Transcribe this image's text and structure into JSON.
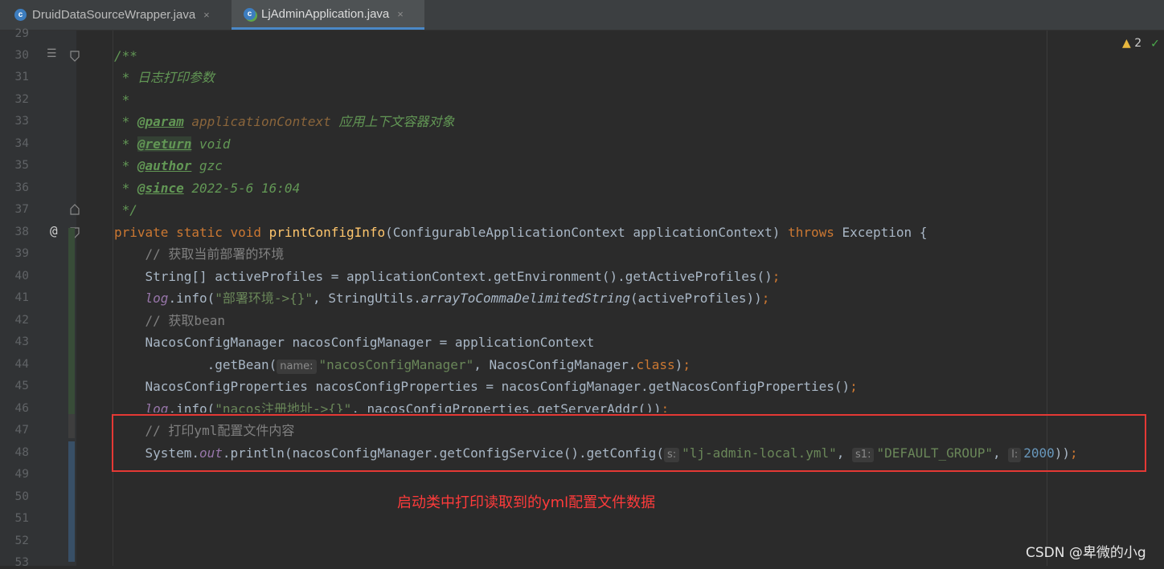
{
  "tabs": [
    {
      "icon": "class-c-icon",
      "icon_letter": "c",
      "label": "DruidDataSourceWrapper.java",
      "close": "×"
    },
    {
      "icon": "springboot-class-icon",
      "icon_letter": "c",
      "label": "LjAdminApplication.java",
      "close": "×"
    }
  ],
  "inspections": {
    "warning_icon": "warning-triangle-icon",
    "warning_symbol": "▲",
    "warning_count": "2",
    "ok_icon": "double-check-icon",
    "ok_symbol": "✓"
  },
  "line_numbers": [
    "29",
    "30",
    "31",
    "32",
    "33",
    "34",
    "35",
    "36",
    "37",
    "38",
    "39",
    "40",
    "41",
    "42",
    "43",
    "44",
    "45",
    "46",
    "47",
    "48",
    "49",
    "50",
    "51",
    "52",
    "53"
  ],
  "gutter": {
    "doc_icon": "☰",
    "override_symbol": "@"
  },
  "code": {
    "l30": "/**",
    "l31": " * 日志打印参数",
    "l32": " *",
    "l33_star": " * ",
    "l33_tag": "@param",
    "l33_param": " applicationContext",
    "l33_text": " 应用上下文容器对象",
    "l34_star": " * ",
    "l34_tag": "@return",
    "l34_text": " void",
    "l35_star": " * ",
    "l35_tag": "@author",
    "l35_text": " gzc",
    "l36_star": " * ",
    "l36_tag": "@since",
    "l36_text": " 2022-5-6 16:04",
    "l37": " */",
    "l38_kw1": "private static void ",
    "l38_fn": "printConfigInfo",
    "l38_args": "(ConfigurableApplicationContext applicationContext) ",
    "l38_kw2": "throws",
    "l38_rest": " Exception {",
    "l39": "    // 获取当前部署的环境",
    "l40_a": "    String[] activeProfiles = applicationContext.getEnvironment().getActiveProfiles()",
    "l40_semi": ";",
    "l41_log": "log",
    "l41_a": ".info(",
    "l41_str": "\"部署环境->{}\"",
    "l41_b": ", StringUtils.",
    "l41_ital": "arrayToCommaDelimitedString",
    "l41_c": "(activeProfiles))",
    "l41_semi": ";",
    "l42": "    // 获取bean",
    "l43": "    NacosConfigManager nacosConfigManager = applicationContext",
    "l44_a": "            .getBean(",
    "l44_hint": "name:",
    "l44_str": "\"nacosConfigManager\"",
    "l44_b": ", NacosConfigManager.",
    "l44_kw": "class",
    "l44_c": ")",
    "l44_semi": ";",
    "l45_a": "    NacosConfigProperties nacosConfigProperties = nacosConfigManager.getNacosConfigProperties()",
    "l45_semi": ";",
    "l46_log": "log",
    "l46_a": ".info(",
    "l46_str": "\"nacos注册地址->{}\"",
    "l46_b": ", nacosConfigProperties.getServerAddr())",
    "l46_semi": ";",
    "l47": "    // 打印yml配置文件内容",
    "l48_a": "    System.",
    "l48_out": "out",
    "l48_b": ".println(nacosConfigManager.getConfigService().getConfig(",
    "l48_hint1": "s:",
    "l48_str1": "\"lj-admin-local.yml\"",
    "l48_comma1": ", ",
    "l48_hint2": "s1:",
    "l48_str2": "\"DEFAULT_GROUP\"",
    "l48_comma2": ", ",
    "l48_hint3": "l:",
    "l48_num": "2000",
    "l48_c": "))",
    "l48_semi": ";"
  },
  "annotation": "启动类中打印读取到的yml配置文件数据",
  "watermark": "CSDN @卑微的小g"
}
